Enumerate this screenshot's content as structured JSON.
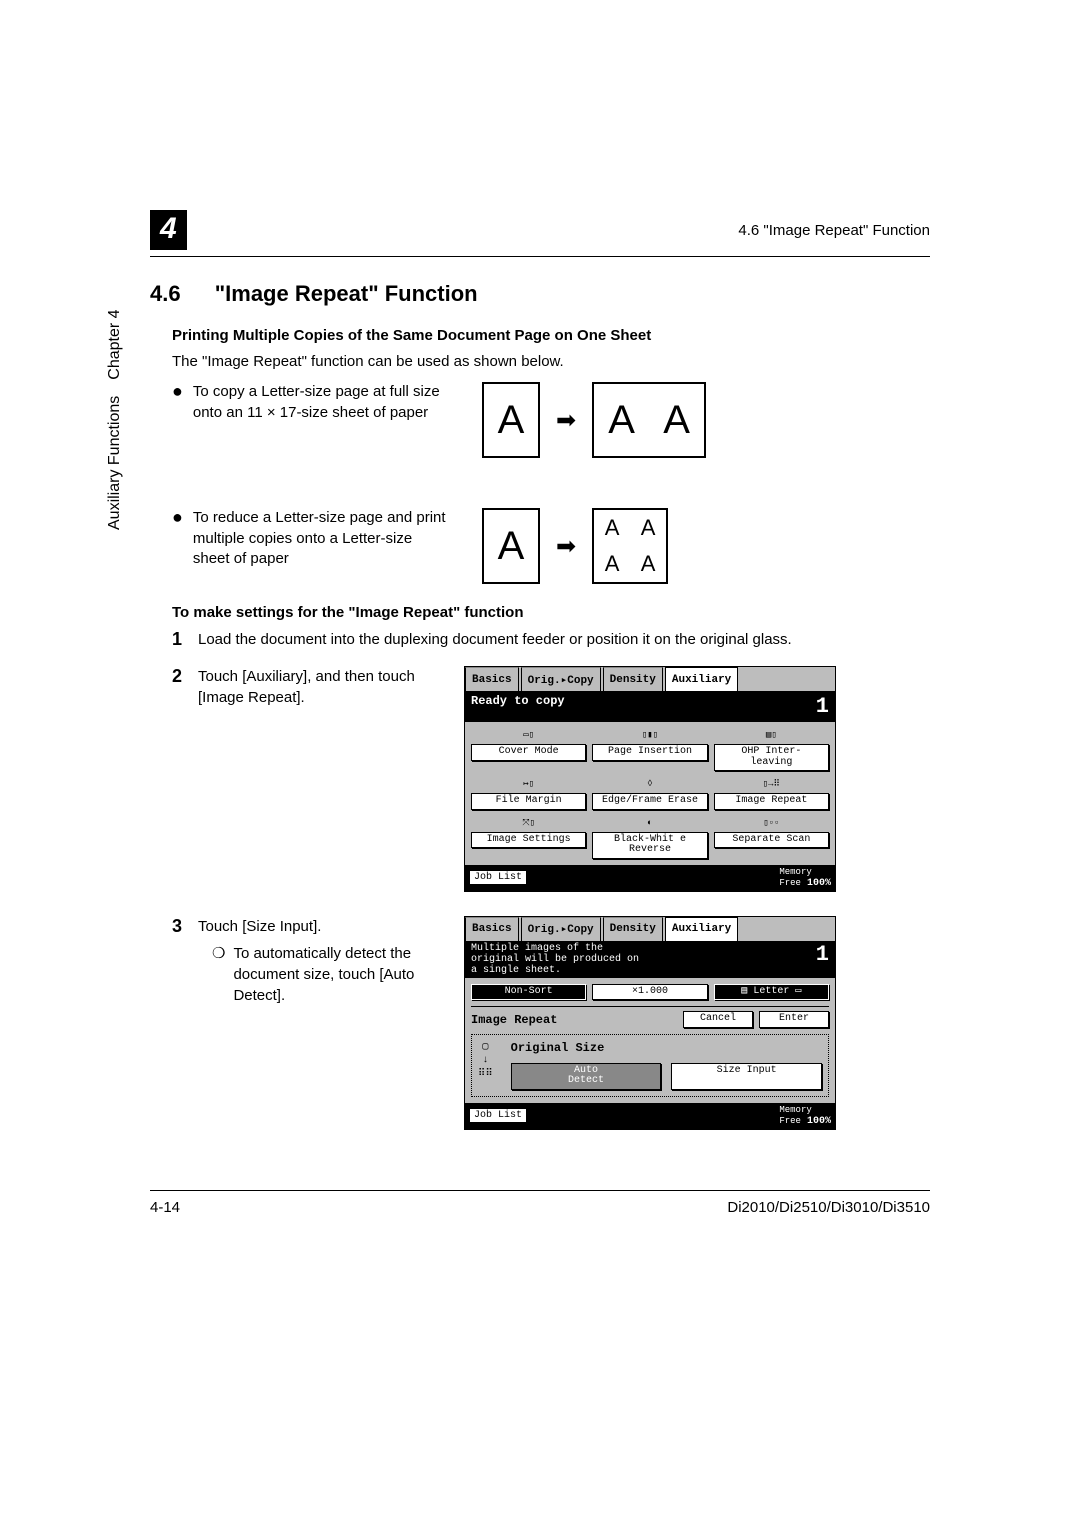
{
  "header": {
    "chapter_number": "4",
    "running_head": "4.6 \"Image Repeat\" Function"
  },
  "section": {
    "number": "4.6",
    "title": "\"Image Repeat\" Function"
  },
  "sub1": "Printing Multiple Copies of the Same Document Page on One Sheet",
  "intro": "The \"Image Repeat\" function can be used as shown below.",
  "bullets": {
    "b1": "To copy a Letter-size page at full size onto an 11 × 17-size sheet of paper",
    "b2": "To reduce a Letter-size page and print multiple copies onto a Letter-size sheet of paper"
  },
  "glyph": {
    "A": "A",
    "arrow": "➡"
  },
  "sub2": "To make settings for the \"Image Repeat\" function",
  "steps": {
    "n1": "1",
    "t1": "Load the document into the duplexing document feeder or position it on the original glass.",
    "n2": "2",
    "t2": "Touch [Auxiliary], and then touch [Image Repeat].",
    "n3": "3",
    "t3": "Touch [Size Input].",
    "t3sub": "To automatically detect the document size, touch [Auto Detect]."
  },
  "sidetab": {
    "text": "Auxiliary Functions",
    "chapter": "Chapter 4"
  },
  "footer": {
    "page": "4-14",
    "models": "Di2010/Di2510/Di3010/Di3510"
  },
  "panel_common": {
    "tabs": {
      "basics": "Basics",
      "orig": "Orig.▸Copy",
      "density": "Density",
      "aux": "Auxiliary"
    },
    "joblist": "Job List",
    "memfree": "Memory\nFree",
    "mem100": "100%",
    "count": "1"
  },
  "panel1": {
    "status": "Ready to copy",
    "buttons": {
      "cover": "Cover Mode",
      "page": "Page\nInsertion",
      "ohp": "OHP Inter-\nleaving",
      "file": "File\nMargin",
      "edge": "Edge/Frame\nErase",
      "image_repeat": "Image\nRepeat",
      "image_settings": "Image\nSettings",
      "bw": "Black-Whit\ne Reverse",
      "separate": "Separate\nScan"
    }
  },
  "panel2": {
    "msg": "Multiple images of the\noriginal will be produced on\na single sheet.",
    "nonsort": "Non-Sort",
    "zoom": "×1.000",
    "paper": "Letter",
    "ir_label": "Image Repeat",
    "cancel": "Cancel",
    "enter": "Enter",
    "origsize_label": "Original Size",
    "auto": "Auto\nDetect",
    "sizeinput": "Size Input"
  }
}
